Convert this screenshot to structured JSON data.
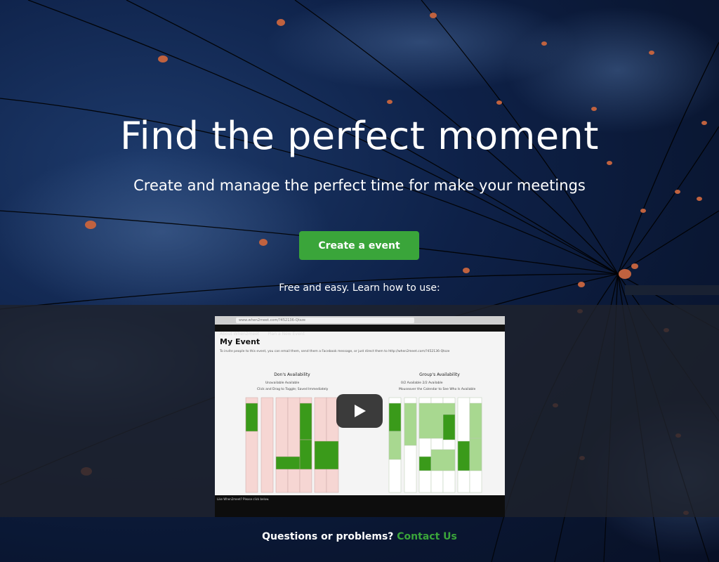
{
  "hero": {
    "title": "Find the perfect moment",
    "subtitle": "Create and manage the perfect time for make your meetings",
    "cta_label": "Create a event",
    "hint": "Free and easy. Learn how to use:"
  },
  "video": {
    "url_text": "www.when2meet.com/?452136-Qtsze",
    "nav_items": [
      "About When2meet",
      "Plan a New Event"
    ],
    "event_title": "My Event",
    "invite_text": "To invite people to this event, you can email them, send them a Facebook message, or just direct them to http://when2meet.com/?452136-Qtsze",
    "left_title": "Don's Availability",
    "left_legend": "Unavailable  Available",
    "left_hint": "Click and Drag to Toggle; Saved Immediately",
    "right_title": "Group's Availability",
    "right_legend": "0/2 Available  2/2 Available",
    "right_hint": "Mouseover the Calendar to See Who Is Available",
    "bottom_caption": "Like When2meet? Please click below.",
    "play_icon": "play-icon"
  },
  "footer": {
    "question": "Questions or problems?",
    "link_label": "Contact Us"
  },
  "colors": {
    "accent": "#3aa53a",
    "available": "#3a9a1a",
    "unavailable": "#f6d6d3"
  }
}
